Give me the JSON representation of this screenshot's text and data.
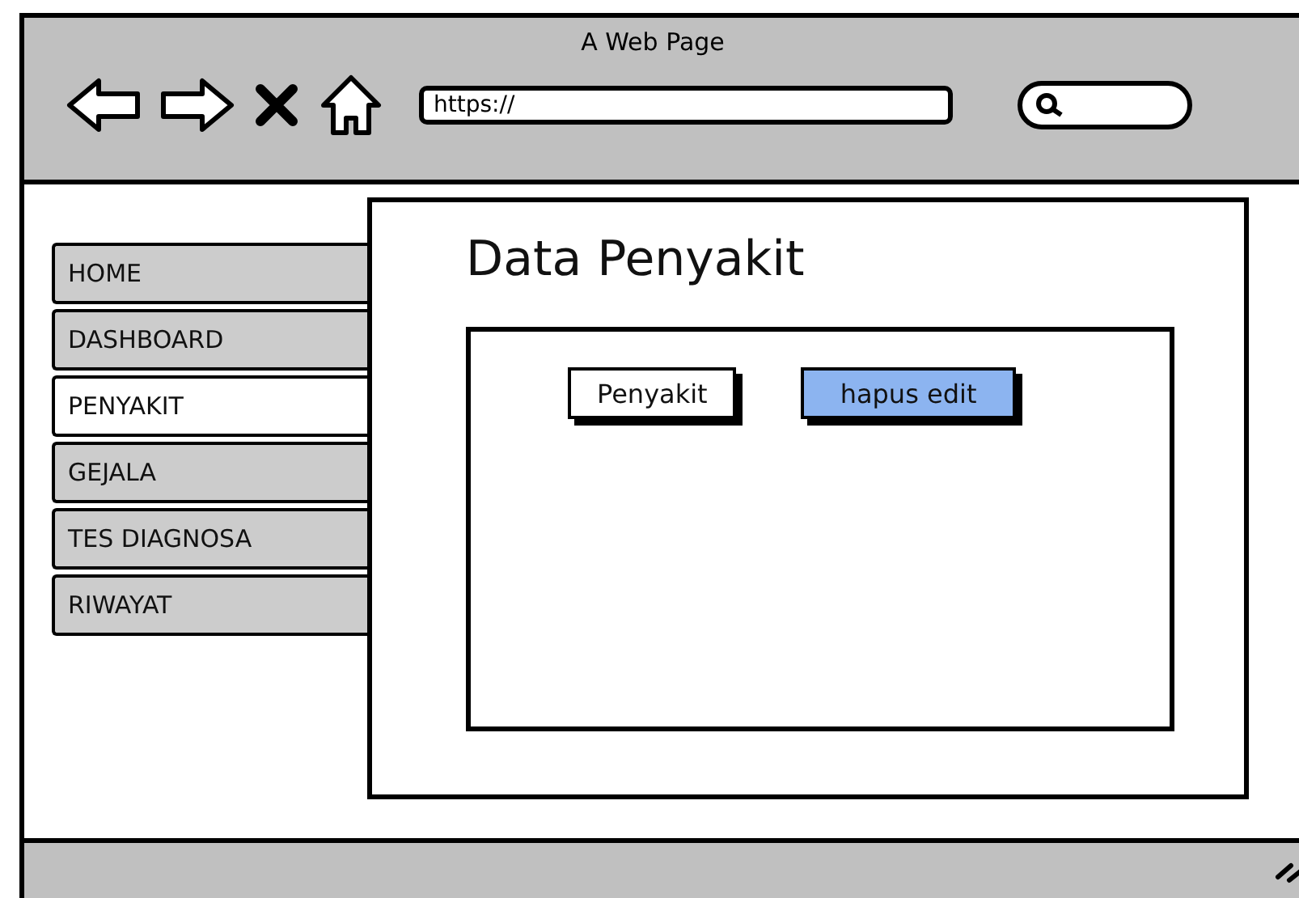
{
  "window": {
    "title": "A Web Page"
  },
  "address_bar": {
    "value": "https://"
  },
  "nav": [
    {
      "label": "HOME",
      "selected": false
    },
    {
      "label": "DASHBOARD",
      "selected": false
    },
    {
      "label": "PENYAKIT",
      "selected": true
    },
    {
      "label": "GEJALA",
      "selected": false
    },
    {
      "label": "TES DIAGNOSA",
      "selected": false
    },
    {
      "label": "RIWAYAT",
      "selected": false
    }
  ],
  "content": {
    "title": "Data Penyakit",
    "buttons": [
      {
        "label": "Penyakit",
        "selected": false
      },
      {
        "label": "hapus edit",
        "selected": true
      }
    ]
  }
}
